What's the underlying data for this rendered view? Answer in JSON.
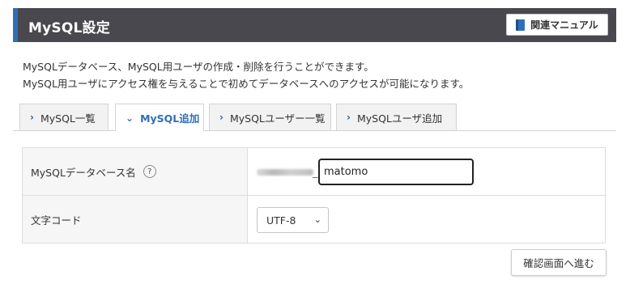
{
  "header": {
    "title": "MySQL設定",
    "manual_label": "関連マニュアル"
  },
  "description": {
    "line1": "MySQLデータベース、MySQL用ユーザの作成・削除を行うことができます。",
    "line2": "MySQL用ユーザにアクセス権を与えることで初めてデータベースへのアクセスが可能になります。"
  },
  "tabs": [
    {
      "label": "MySQL一覧",
      "active": false
    },
    {
      "label": "MySQL追加",
      "active": true
    },
    {
      "label": "MySQLユーザー一覧",
      "active": false
    },
    {
      "label": "MySQLユーザ追加",
      "active": false
    }
  ],
  "form": {
    "db_name_label": "MySQLデータベース名",
    "help_glyph": "?",
    "db_prefix_separator": "_",
    "db_name_value": "matomo",
    "charset_label": "文字コード",
    "charset_value": "UTF-8"
  },
  "actions": {
    "confirm_label": "確認画面へ進む"
  },
  "colors": {
    "header_bg": "#48484e",
    "accent": "#2f6fb6"
  }
}
